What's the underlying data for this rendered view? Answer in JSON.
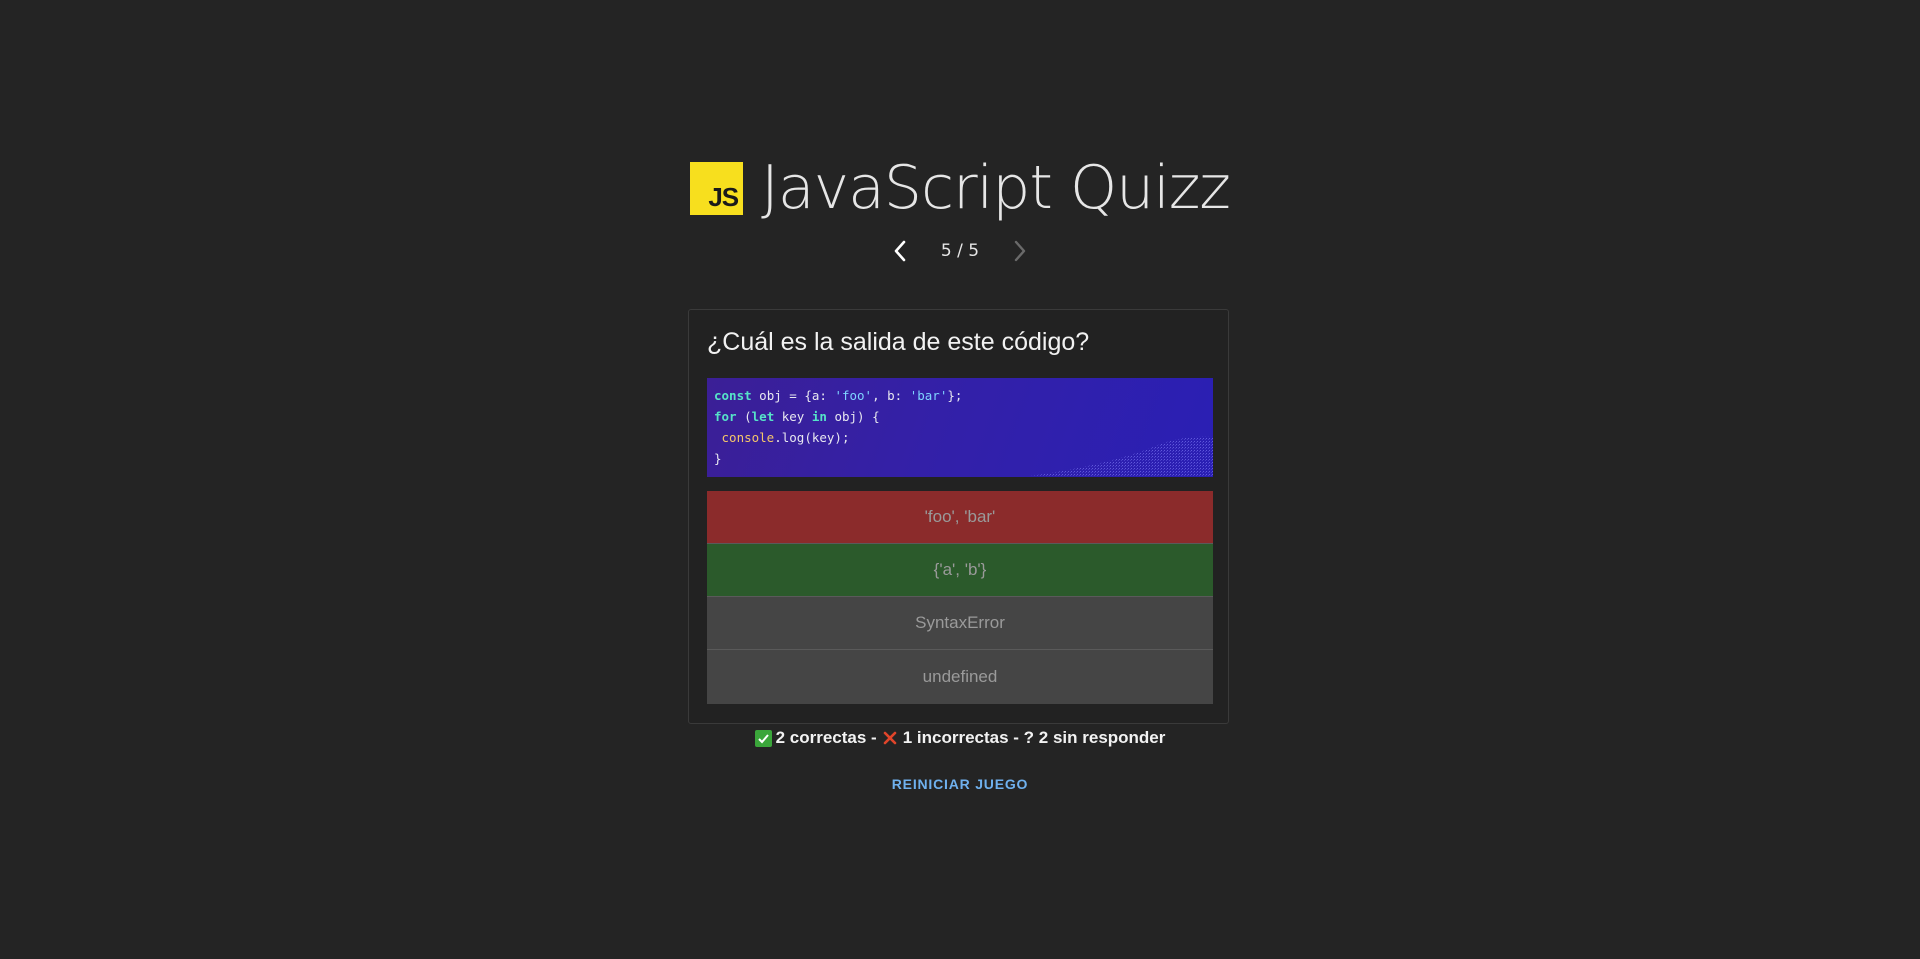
{
  "header": {
    "logo_text": "JS",
    "title": "JavaScript Quizz"
  },
  "pager": {
    "current": "5 / 5",
    "prev_icon": "chevron-left-icon",
    "next_icon": "chevron-right-icon"
  },
  "question": {
    "text": "¿Cuál es la salida de este código?",
    "code": [
      [
        "kw:const",
        " obj = {a: ",
        "str:'foo'",
        ", b: ",
        "str:'bar'",
        "};"
      ],
      [
        "kw:for",
        " (",
        "kw:let",
        " key ",
        "kw:in",
        " obj) {"
      ],
      [
        " ",
        "fn:console",
        ".log(key);"
      ],
      [
        "}"
      ]
    ]
  },
  "answers": [
    {
      "label": "'foo', 'bar'",
      "state": "incorrect",
      "color": "#8b2b2b"
    },
    {
      "label": "{'a', 'b'}",
      "state": "correct",
      "color": "#2b5a2b"
    },
    {
      "label": "SyntaxError",
      "state": "neutral",
      "color": "#454545"
    },
    {
      "label": "undefined",
      "state": "neutral",
      "color": "#454545"
    }
  ],
  "score": {
    "correct": "2 correctas -",
    "incorrect": "1 incorrectas - ? 2 sin responder"
  },
  "restart_label": "REINICIAR JUEGO"
}
